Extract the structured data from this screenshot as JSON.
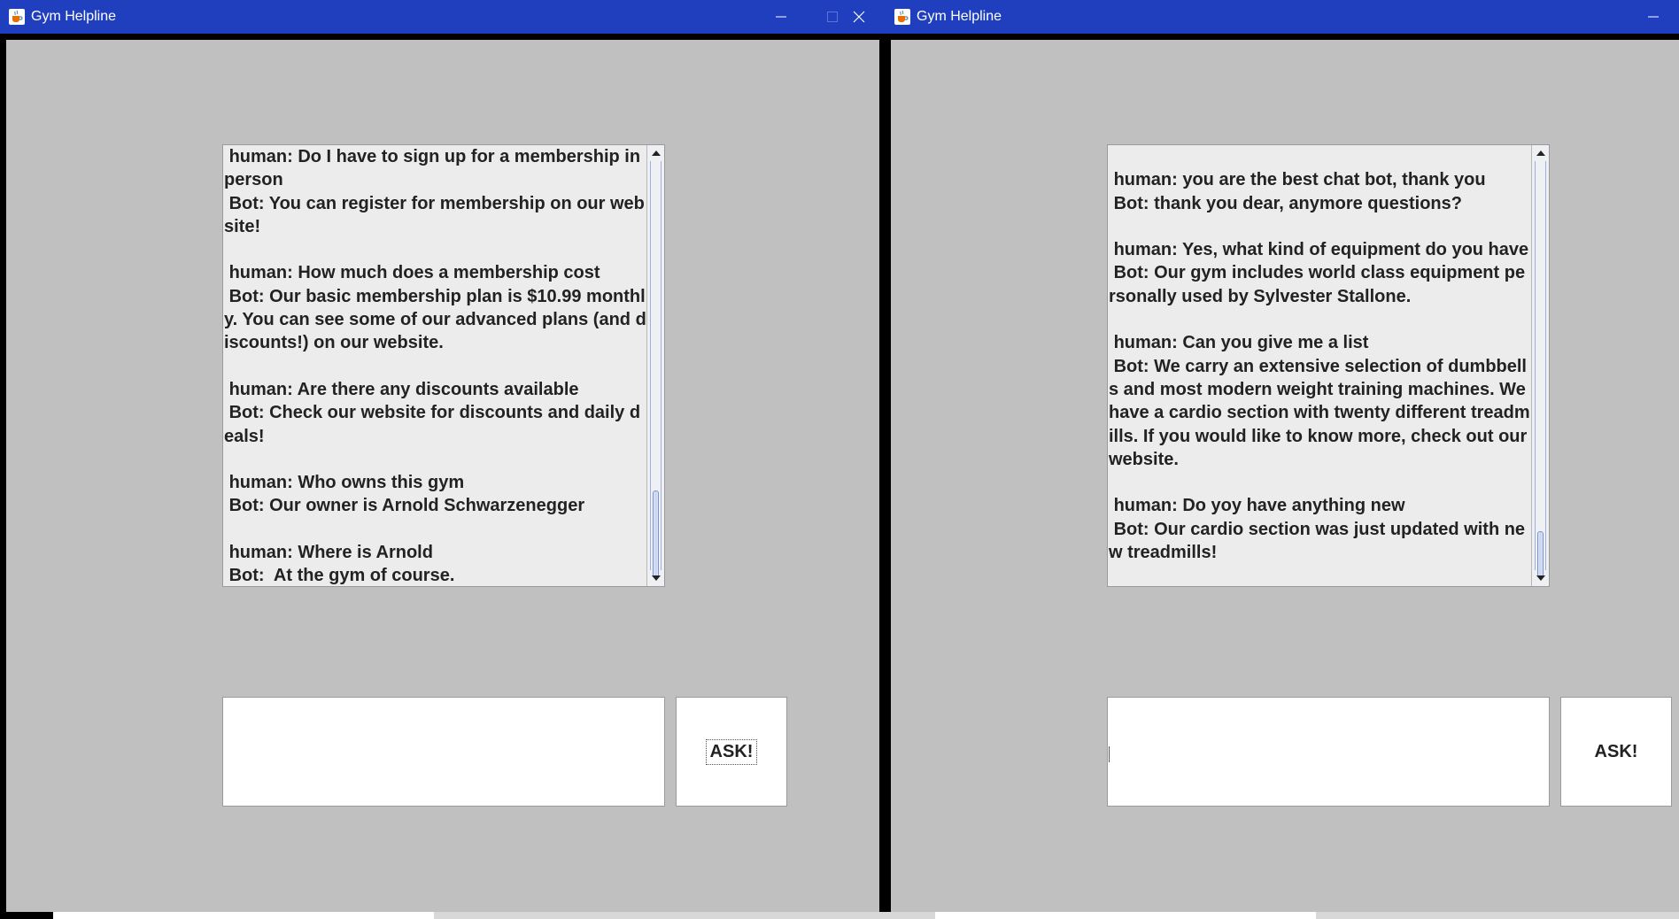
{
  "windows": [
    {
      "title": "Gym Helpline",
      "controls": [
        "minimize",
        "maximize",
        "close"
      ],
      "chat": {
        "messages": [
          " human: Do I have to sign up for a membership in person",
          " Bot: You can register for membership on our website!",
          "",
          " human: How much does a membership cost",
          " Bot: Our basic membership plan is $10.99 monthly. You can see some of our advanced plans (and discounts!) on our website.",
          "",
          " human: Are there any discounts available",
          " Bot: Check our website for discounts and daily deals!",
          "",
          " human: Who owns this gym",
          " Bot: Our owner is Arnold Schwarzenegger",
          "",
          " human: Where is Arnold",
          " Bot:  At the gym of course."
        ],
        "scroll_position": 0.78
      },
      "input_value": "",
      "ask_label": "ASK!"
    },
    {
      "title": "Gym Helpline",
      "controls": [
        "minimize"
      ],
      "chat": {
        "messages": [
          "",
          " human: you are the best chat bot, thank you",
          " Bot: thank you dear, anymore questions?",
          "",
          " human: Yes, what kind of equipment do you have",
          " Bot: Our gym includes world class equipment personally used by Sylvester Stallone.",
          "",
          " human: Can you give me a list",
          " Bot: We carry an extensive selection of dumbbells and most modern weight training machines. We have a cardio section with twenty different treadmills. If you would like to know more, check out our website.",
          "",
          " human: Do yoy have anything new",
          " Bot: Our cardio section was just updated with new treadmills!"
        ],
        "scroll_position": 0.93
      },
      "input_value": "",
      "ask_label": "ASK!"
    }
  ],
  "colors": {
    "titlebar": "#1f3fbf",
    "content_bg": "#c0c0c0",
    "chat_bg": "#ececec"
  },
  "icons": [
    "java-coffee-icon",
    "minimize-icon",
    "maximize-icon",
    "close-icon",
    "scroll-up-icon",
    "scroll-down-icon"
  ]
}
